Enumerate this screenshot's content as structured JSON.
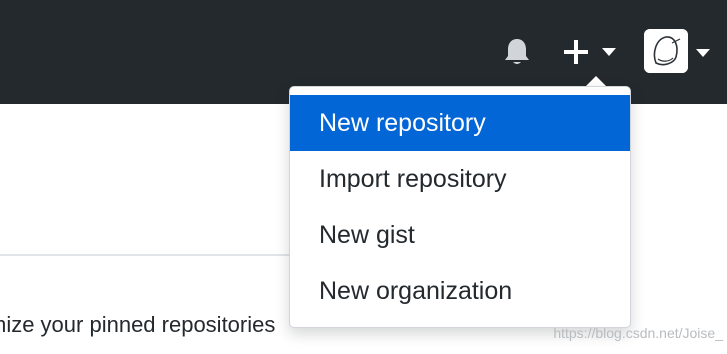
{
  "header": {
    "notifications_icon": "bell-icon",
    "create_icon": "plus-icon",
    "create_caret_icon": "caret-down-icon",
    "avatar_caret_icon": "caret-down-icon",
    "background_color": "#24292e"
  },
  "dropdown": {
    "items": [
      {
        "label": "New repository",
        "active": true
      },
      {
        "label": "Import repository",
        "active": false
      },
      {
        "label": "New gist",
        "active": false
      },
      {
        "label": "New organization",
        "active": false
      }
    ],
    "active_color": "#0366d6"
  },
  "content": {
    "pinned_text": "mize your pinned repositories"
  },
  "watermark": "https://blog.csdn.net/Joise_"
}
